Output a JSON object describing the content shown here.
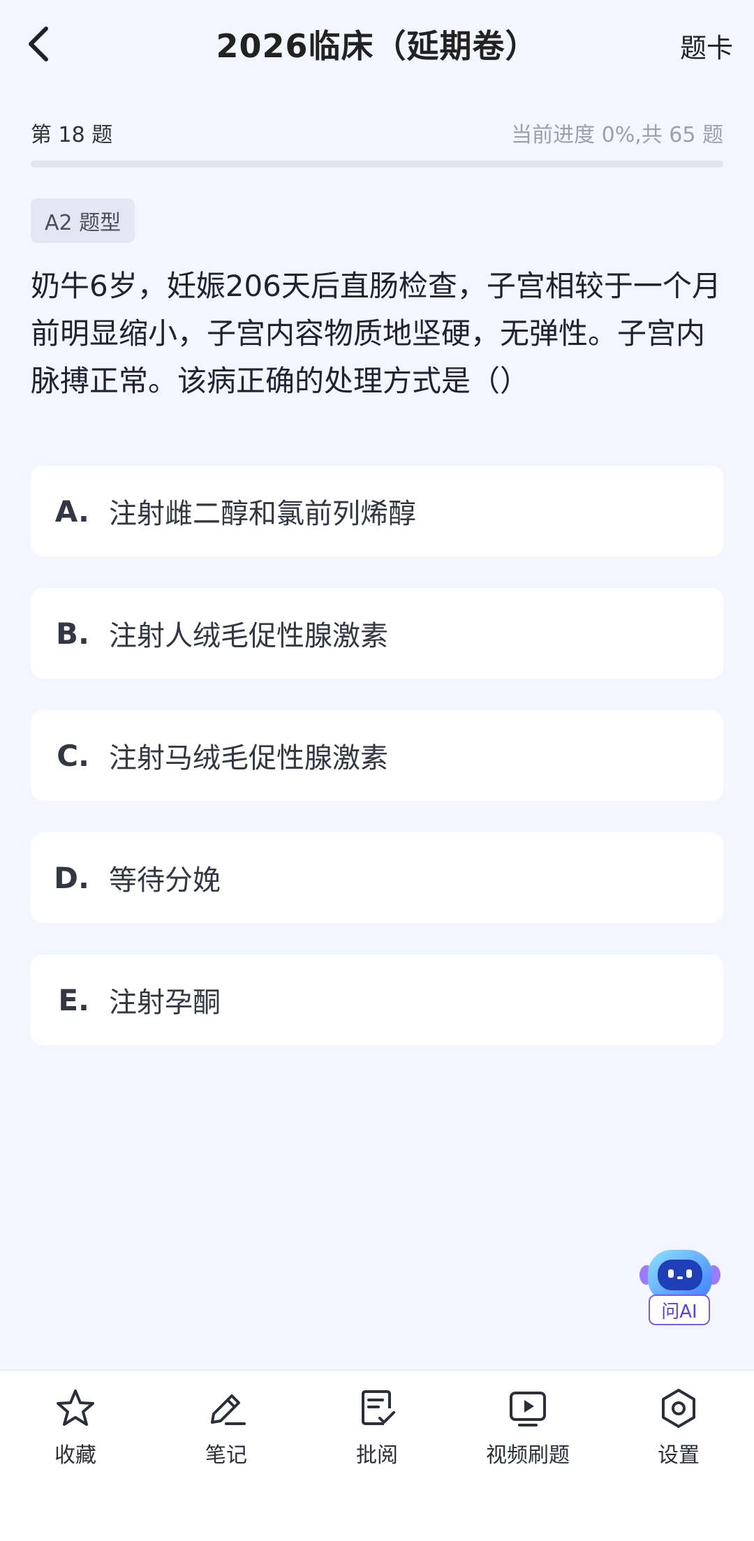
{
  "header": {
    "title": "2026临床（延期卷）",
    "card_label": "题卡"
  },
  "progress": {
    "question_number": "第 18 题",
    "status_text": "当前进度 0%,共 65 题",
    "percent": 0
  },
  "question": {
    "type_tag": "A2 题型",
    "stem": "奶牛6岁，妊娠206天后直肠检查，子宫相较于一个月前明显缩小，子宫内容物质地坚硬，无弹性。子宫内脉搏正常。该病正确的处理方式是（）",
    "options": [
      {
        "letter": "A.",
        "text": "注射雌二醇和氯前列烯醇"
      },
      {
        "letter": "B.",
        "text": "注射人绒毛促性腺激素"
      },
      {
        "letter": "C.",
        "text": "注射马绒毛促性腺激素"
      },
      {
        "letter": "D.",
        "text": "等待分娩"
      },
      {
        "letter": "E.",
        "text": "注射孕酮"
      }
    ]
  },
  "ai_button": {
    "label": "问AI"
  },
  "bottom_bar": {
    "items": [
      {
        "label": "收藏",
        "icon": "star-icon"
      },
      {
        "label": "笔记",
        "icon": "pencil-icon"
      },
      {
        "label": "批阅",
        "icon": "review-icon"
      },
      {
        "label": "视频刷题",
        "icon": "video-icon"
      },
      {
        "label": "设置",
        "icon": "settings-icon"
      }
    ]
  },
  "colors": {
    "background": "#F3F6FE",
    "accent": "#4A7BFF",
    "ai_purple": "#7A5CF0"
  }
}
